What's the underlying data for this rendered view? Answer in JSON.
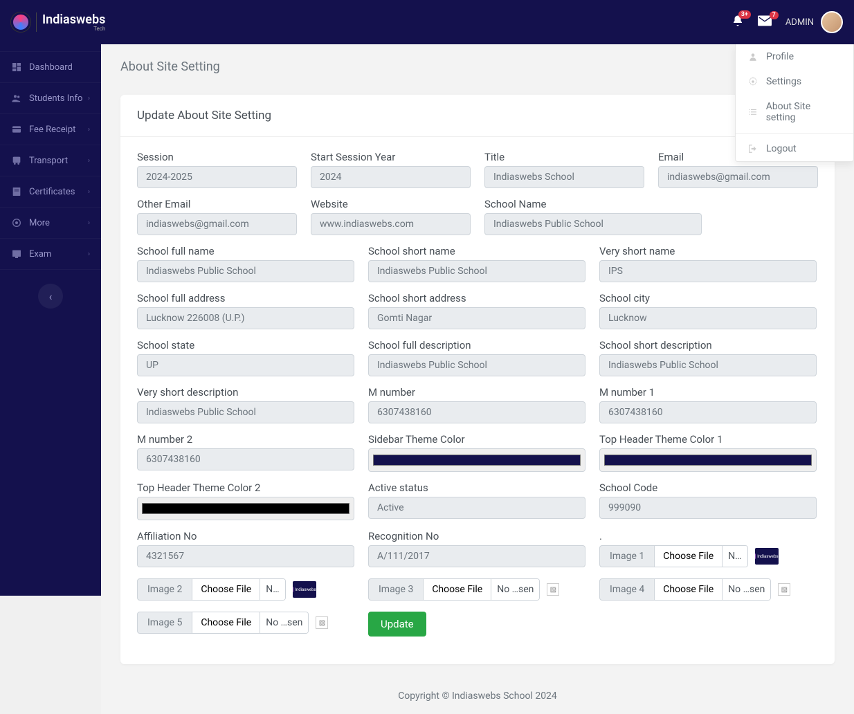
{
  "brand": {
    "name": "Indiaswebs",
    "sub": "Tech"
  },
  "header": {
    "notif_badge": "3+",
    "mail_badge": "7",
    "user_label": "ADMIN"
  },
  "dropdown": {
    "profile": "Profile",
    "settings": "Settings",
    "about": "About Site setting",
    "logout": "Logout"
  },
  "sidebar": {
    "items": [
      {
        "label": "Dashboard",
        "expandable": false
      },
      {
        "label": "Students Info",
        "expandable": true
      },
      {
        "label": "Fee Receipt",
        "expandable": true
      },
      {
        "label": "Transport",
        "expandable": true
      },
      {
        "label": "Certificates",
        "expandable": true
      },
      {
        "label": "More",
        "expandable": true
      },
      {
        "label": "Exam",
        "expandable": true
      }
    ]
  },
  "page": {
    "title": "About Site Setting",
    "card_title": "Update About Site Setting"
  },
  "form": {
    "session": {
      "label": "Session",
      "value": "2024-2025"
    },
    "start_year": {
      "label": "Start Session Year",
      "value": "2024"
    },
    "title": {
      "label": "Title",
      "value": "Indiaswebs School"
    },
    "email": {
      "label": "Email",
      "value": "indiaswebs@gmail.com"
    },
    "other_email": {
      "label": "Other Email",
      "value": "indiaswebs@gmail.com"
    },
    "website": {
      "label": "Website",
      "value": "www.indiaswebs.com"
    },
    "school_name": {
      "label": "School Name",
      "value": "Indiaswebs Public School"
    },
    "full_name": {
      "label": "School full name",
      "value": "Indiaswebs Public School"
    },
    "short_name": {
      "label": "School short name",
      "value": "Indiaswebs Public School"
    },
    "vshort_name": {
      "label": "Very short name",
      "value": "IPS"
    },
    "full_addr": {
      "label": "School full address",
      "value": "Lucknow 226008 (U.P.)"
    },
    "short_addr": {
      "label": "School short address",
      "value": "Gomti Nagar"
    },
    "city": {
      "label": "School city",
      "value": "Lucknow"
    },
    "state": {
      "label": "School state",
      "value": "UP"
    },
    "full_desc": {
      "label": "School full description",
      "value": "Indiaswebs Public School"
    },
    "short_desc": {
      "label": "School short description",
      "value": "Indiaswebs Public School"
    },
    "vshort_desc": {
      "label": "Very short description",
      "value": "Indiaswebs Public School"
    },
    "mnum": {
      "label": "M number",
      "value": "6307438160"
    },
    "mnum1": {
      "label": "M number 1",
      "value": "6307438160"
    },
    "mnum2": {
      "label": "M number 2",
      "value": "6307438160"
    },
    "sidebar_color": {
      "label": "Sidebar Theme Color",
      "value": "#14114d"
    },
    "header_color1": {
      "label": "Top Header Theme Color 1",
      "value": "#14114d"
    },
    "header_color2": {
      "label": "Top Header Theme Color 2",
      "value": "#000000"
    },
    "active": {
      "label": "Active status",
      "value": "Active"
    },
    "school_code": {
      "label": "School Code",
      "value": "999090"
    },
    "affiliation": {
      "label": "Affiliation No",
      "value": "4321567"
    },
    "recognition": {
      "label": "Recognition No",
      "value": "A/111/2017"
    },
    "dot_label": ".",
    "img1_label": "Image 1",
    "img2_label": "Image 2",
    "img3_label": "Image 3",
    "img4_label": "Image 4",
    "img5_label": "Image 5",
    "choose_file": "Choose File",
    "no_file": "N…",
    "no_file_long": "No …sen",
    "update": "Update"
  },
  "footer": {
    "text": "Copyright © Indiaswebs School 2024"
  }
}
